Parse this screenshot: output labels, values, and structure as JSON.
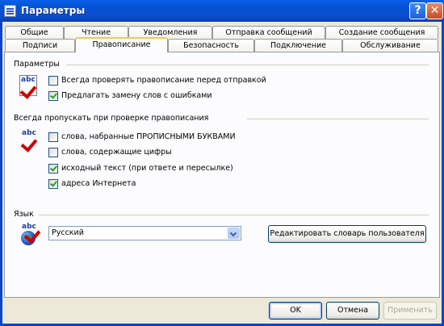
{
  "window": {
    "title": "Параметры"
  },
  "tabs_row1": [
    "Общие",
    "Чтение",
    "Уведомления",
    "Отправка сообщений",
    "Создание сообщения"
  ],
  "tabs_row2": [
    "Подписи",
    "Правописание",
    "Безопасность",
    "Подключение",
    "Обслуживание"
  ],
  "active_tab": "Правописание",
  "groups": {
    "params": {
      "label": "Параметры",
      "items": [
        {
          "label": "Всегда проверять правописание перед отправкой",
          "checked": false
        },
        {
          "label": "Предлагать замену слов с ошибками",
          "checked": true
        }
      ]
    },
    "skip": {
      "label": "Всегда пропускать при проверке правописания",
      "items": [
        {
          "label": "слова, набранные ПРОПИСНЫМИ БУКВАМИ",
          "checked": false
        },
        {
          "label": "слова, содержащие цифры",
          "checked": false
        },
        {
          "label": "исходный текст (при ответе и пересылке)",
          "checked": true
        },
        {
          "label": "адреса Интернета",
          "checked": true
        }
      ]
    },
    "language": {
      "label": "Язык",
      "selected": "Русский",
      "edit_dict_label": "Редактировать словарь пользователя"
    }
  },
  "buttons": {
    "ok": "OK",
    "cancel": "Отмена",
    "apply": "Применить"
  },
  "icons": {
    "abc_text": "abc"
  }
}
